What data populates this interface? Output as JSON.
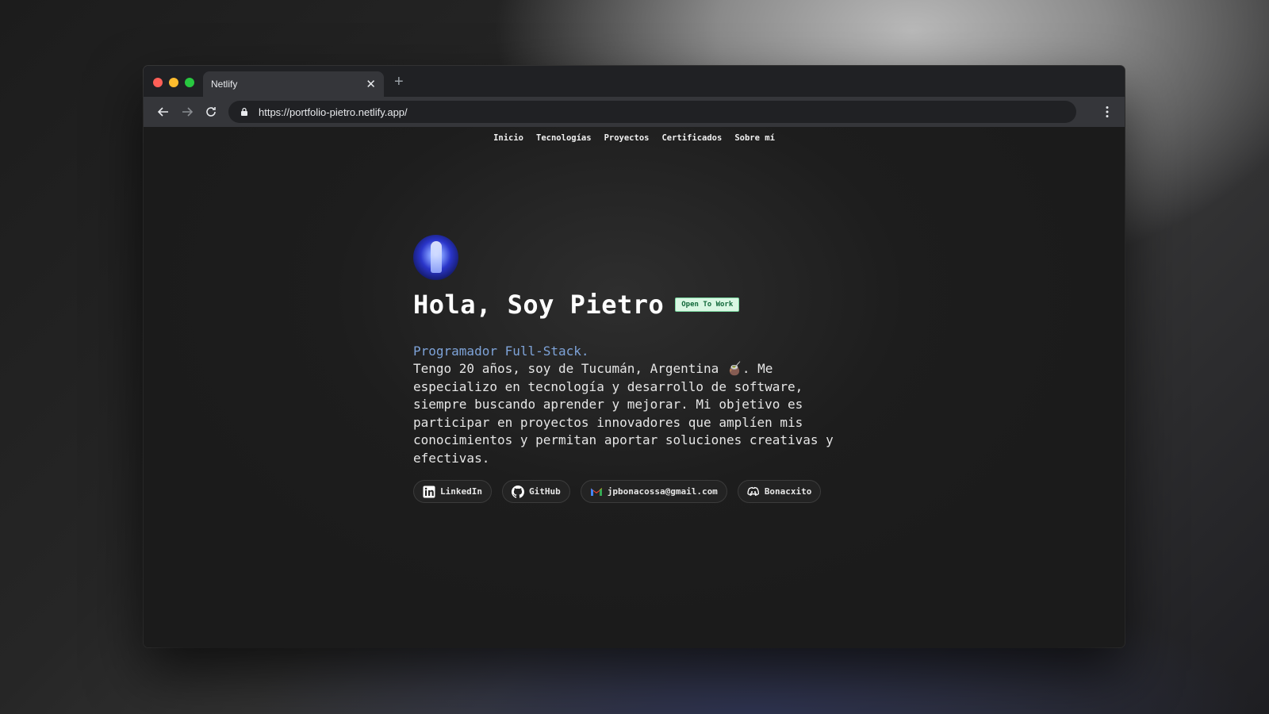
{
  "browser": {
    "tab_title": "Netlify",
    "url": "https://portfolio-pietro.netlify.app/"
  },
  "site_nav": [
    "Inicio",
    "Tecnologías",
    "Proyectos",
    "Certificados",
    "Sobre mí"
  ],
  "hero": {
    "title": "Hola, Soy Pietro",
    "badge": "Open To Work",
    "role": "Programador Full-Stack.",
    "bio": "Tengo 20 años, soy de Tucumán, Argentina 🧉. Me especializo en tecnología y desarrollo de software, siempre buscando aprender y mejorar. Mi objetivo es participar en proyectos innovadores que amplíen mis conocimientos y permitan aportar soluciones creativas y efectivas."
  },
  "links": [
    {
      "label": "LinkedIn",
      "icon": "linkedin-icon"
    },
    {
      "label": "GitHub",
      "icon": "github-icon"
    },
    {
      "label": "jpbonacossa@gmail.com",
      "icon": "gmail-icon"
    },
    {
      "label": "Bonacxito",
      "icon": "discord-icon"
    }
  ],
  "colors": {
    "role_accent": "#7ea3d8",
    "badge_bg": "#d9f7e3",
    "badge_text": "#11683a"
  }
}
